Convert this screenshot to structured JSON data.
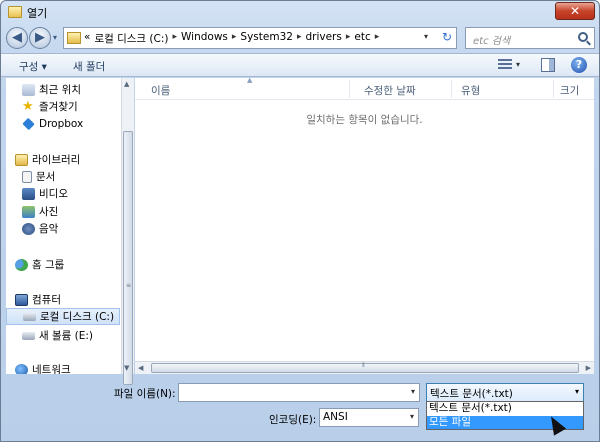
{
  "window": {
    "title": "열기",
    "close_label": "✕"
  },
  "nav": {
    "back": "◀",
    "forward": "▶",
    "history_dropdown": "▾"
  },
  "address": {
    "prefix": "«",
    "crumbs": [
      "로컬 디스크 (C:)",
      "Windows",
      "System32",
      "drivers",
      "etc"
    ],
    "separator": "▸",
    "dropdown": "▾",
    "refresh": "↻"
  },
  "search": {
    "placeholder": "etc 검색"
  },
  "toolbar": {
    "organize_label": "구성 ▾",
    "new_folder_label": "새 폴더",
    "help_label": "?"
  },
  "sidebar": {
    "items": [
      {
        "label": "최근 위치",
        "icon": "recent-places-icon"
      },
      {
        "label": "즐겨찾기",
        "icon": "star-icon"
      },
      {
        "label": "Dropbox",
        "icon": "dropbox-icon"
      },
      {
        "label": "라이브러리",
        "icon": "library-icon"
      },
      {
        "label": "문서",
        "icon": "document-icon"
      },
      {
        "label": "비디오",
        "icon": "video-icon"
      },
      {
        "label": "사진",
        "icon": "picture-icon"
      },
      {
        "label": "음악",
        "icon": "music-icon"
      },
      {
        "label": "홈 그룹",
        "icon": "homegroup-icon"
      },
      {
        "label": "컴퓨터",
        "icon": "computer-icon"
      },
      {
        "label": "로컬 디스크 (C:)",
        "icon": "drive-icon"
      },
      {
        "label": "새 볼륨 (E:)",
        "icon": "drive-icon"
      },
      {
        "label": "네트워크",
        "icon": "network-icon"
      }
    ]
  },
  "file_list": {
    "columns": [
      "이름",
      "수정한 날짜",
      "유형",
      "크기"
    ],
    "empty_message": "일치하는 항목이 없습니다."
  },
  "footer": {
    "filename_label": "파일 이름(N):",
    "filename_value": "",
    "encoding_label": "인코딩(E):",
    "encoding_value": "ANSI",
    "filetype_value": "텍스트 문서(*.txt)",
    "filetype_options": [
      "텍스트 문서(*.txt)",
      "모든 파일"
    ],
    "selected_option_index": 1
  }
}
